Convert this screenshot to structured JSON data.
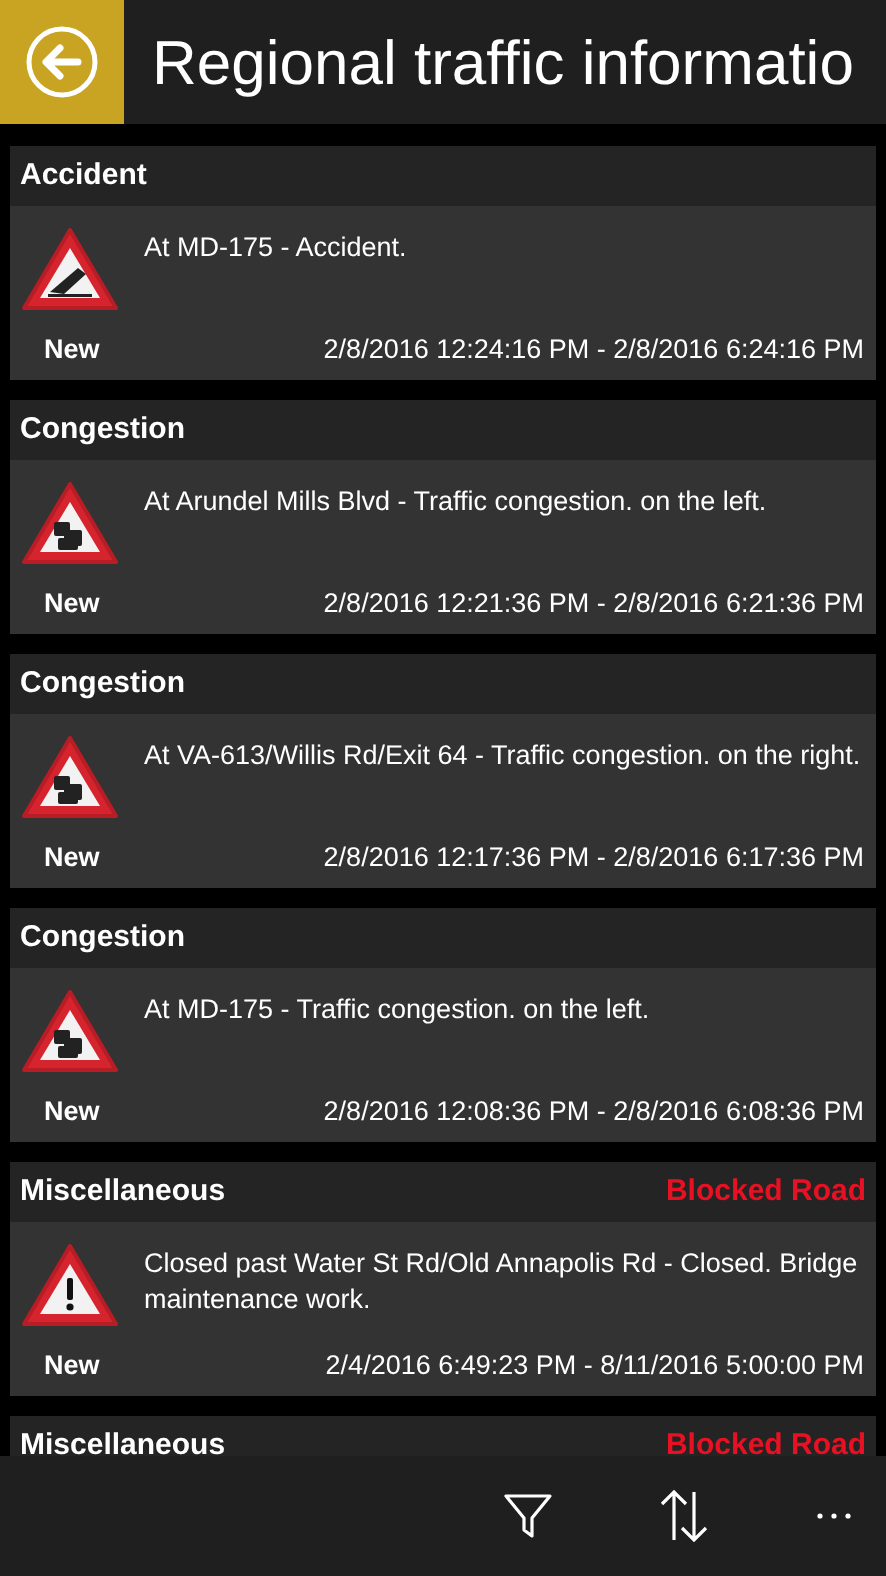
{
  "header": {
    "title": "Regional traffic informatio"
  },
  "incidents": [
    {
      "category": "Accident",
      "kind": "accident",
      "message": "At MD-175 - Accident.",
      "badge": "New",
      "period": "2/8/2016 12:24:16 PM - 2/8/2016 6:24:16 PM"
    },
    {
      "category": "Congestion",
      "kind": "congestion",
      "message": "At Arundel Mills Blvd - Traffic congestion. on the left.",
      "badge": "New",
      "period": "2/8/2016 12:21:36 PM - 2/8/2016 6:21:36 PM"
    },
    {
      "category": "Congestion",
      "kind": "congestion",
      "message": "At VA-613/Willis Rd/Exit 64 - Traffic congestion. on the right.",
      "badge": "New",
      "period": "2/8/2016 12:17:36 PM - 2/8/2016 6:17:36 PM"
    },
    {
      "category": "Congestion",
      "kind": "congestion",
      "message": "At MD-175 - Traffic congestion. on the left.",
      "badge": "New",
      "period": "2/8/2016 12:08:36 PM - 2/8/2016 6:08:36 PM"
    },
    {
      "category": "Miscellaneous",
      "kind": "general",
      "status": "Blocked Road",
      "message": "Closed past Water St Rd/Old Annapolis Rd - Closed. Bridge maintenance work.",
      "badge": "New",
      "period": "2/4/2016 6:49:23 PM - 8/11/2016 5:00:00 PM"
    },
    {
      "category": "Miscellaneous",
      "status": "Blocked Road"
    }
  ]
}
